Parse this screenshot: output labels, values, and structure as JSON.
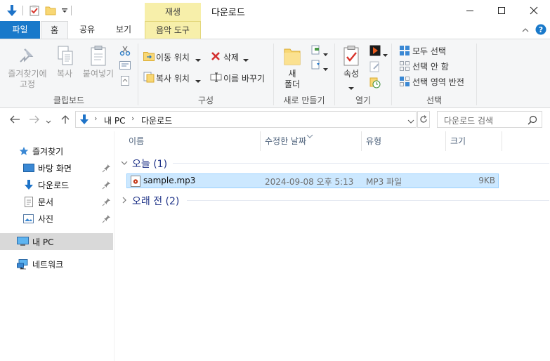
{
  "window": {
    "title": "다운로드",
    "context_tab_header": "재생"
  },
  "tabs": {
    "file": "파일",
    "home": "홈",
    "share": "공유",
    "view": "보기",
    "music_tools": "음악 도구"
  },
  "ribbon": {
    "clipboard": {
      "pin": "즐겨찾기에\n고정",
      "copy": "복사",
      "paste": "붙여넣기",
      "group": "클립보드"
    },
    "organize": {
      "move_to": "이동 위치",
      "copy_to": "복사 위치",
      "delete": "삭제",
      "rename": "이름 바꾸기",
      "group": "구성"
    },
    "new": {
      "new_folder": "새\n폴더",
      "group": "새로 만들기"
    },
    "open": {
      "properties": "속성",
      "group": "열기"
    },
    "select": {
      "select_all": "모두 선택",
      "select_none": "선택 안 함",
      "invert": "선택 영역 반전",
      "group": "선택"
    }
  },
  "address": {
    "crumb_pc": "내 PC",
    "crumb_downloads": "다운로드",
    "search_placeholder": "다운로드 검색"
  },
  "nav": {
    "quick_access": "즐겨찾기",
    "desktop": "바탕 화면",
    "downloads": "다운로드",
    "documents": "문서",
    "pictures": "사진",
    "this_pc": "내 PC",
    "network": "네트워크"
  },
  "columns": {
    "name": "이름",
    "modified": "수정한 날짜",
    "type": "유형",
    "size": "크기"
  },
  "groups": {
    "today": "오늘 (1)",
    "long_ago": "오래 전 (2)"
  },
  "files": [
    {
      "name": "sample.mp3",
      "modified": "2024-09-08 오후 5:13",
      "type": "MP3 파일",
      "size": "9KB"
    }
  ],
  "colors": {
    "accent": "#1979ca",
    "context_tab": "#f7efaa",
    "selection": "#cce8ff",
    "selection_border": "#99d1ff"
  }
}
